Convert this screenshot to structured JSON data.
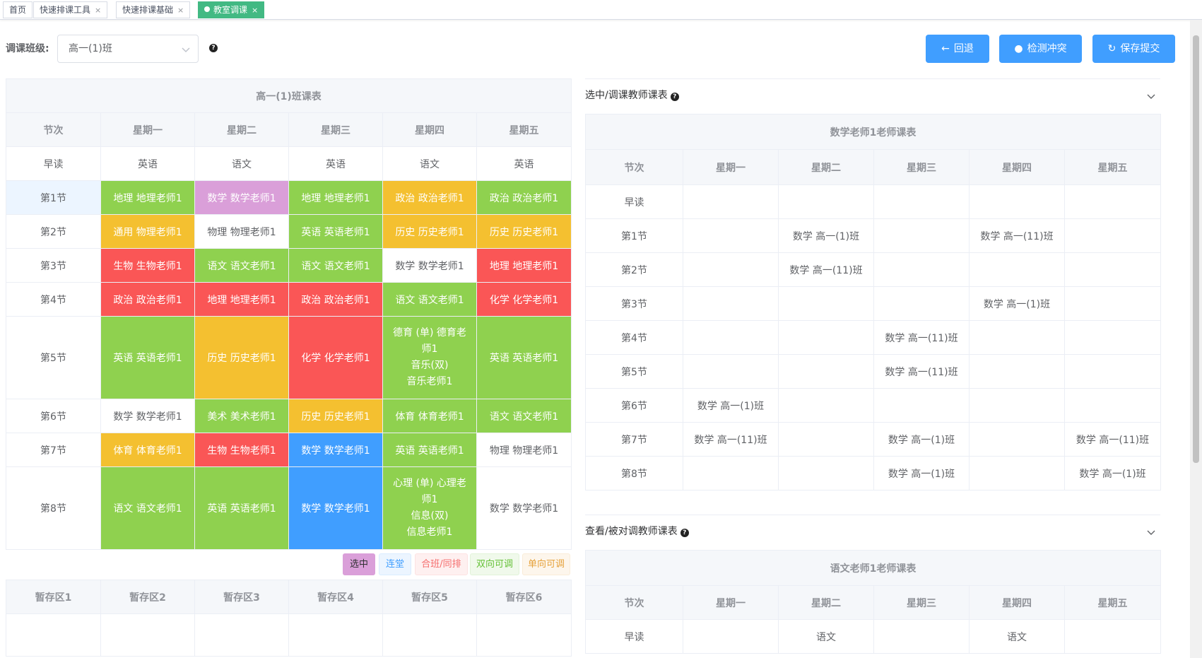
{
  "tabs": [
    {
      "label": "首页",
      "closable": false
    },
    {
      "label": "快速排课工具",
      "closable": true
    },
    {
      "label": "快速排课基础",
      "closable": true
    },
    {
      "label": "教室调课",
      "closable": true,
      "active": true
    }
  ],
  "filter": {
    "label": "调课班级:",
    "selected": "高一(1)班"
  },
  "buttons": {
    "back": "回退",
    "check": "检测冲突",
    "save": "保存提交"
  },
  "class_table": {
    "title": "高一(1)班课表",
    "headers": [
      "节次",
      "星期一",
      "星期二",
      "星期三",
      "星期四",
      "星期五"
    ],
    "rows": [
      {
        "period": "早读",
        "cells": [
          "英语",
          "语文",
          "英语",
          "语文",
          "英语"
        ]
      },
      {
        "period": "第1节",
        "cells": [
          "地理 地理老师1",
          "数学 数学老师1",
          "地理 地理老师1",
          "政治 政治老师1",
          "政治 政治老师1"
        ]
      },
      {
        "period": "第2节",
        "cells": [
          "通用 物理老师1",
          "物理 物理老师1",
          "英语 英语老师1",
          "历史 历史老师1",
          "历史 历史老师1"
        ]
      },
      {
        "period": "第3节",
        "cells": [
          "生物 生物老师1",
          "语文 语文老师1",
          "语文 语文老师1",
          "数学 数学老师1",
          "地理 地理老师1"
        ]
      },
      {
        "period": "第4节",
        "cells": [
          "政治 政治老师1",
          "地理 地理老师1",
          "政治 政治老师1",
          "语文 语文老师1",
          "化学 化学老师1"
        ]
      },
      {
        "period": "第5节",
        "cells": [
          "英语 英语老师1",
          "历史 历史老师1",
          "化学 化学老师1",
          "德育 (单) 德育老|师1|音乐(双)|音乐老师1",
          "英语 英语老师1"
        ]
      },
      {
        "period": "第6节",
        "cells": [
          "数学 数学老师1",
          "美术 美术老师1",
          "历史 历史老师1",
          "体育 体育老师1",
          "语文 语文老师1"
        ]
      },
      {
        "period": "第7节",
        "cells": [
          "体育 体育老师1",
          "生物 生物老师1",
          "数学 数学老师1",
          "英语 英语老师1",
          "物理 物理老师1"
        ]
      },
      {
        "period": "第8节",
        "cells": [
          "语文 语文老师1",
          "英语 英语老师1",
          "数学 数学老师1",
          "心理 (单) 心理老|师1|信息(双)|信息老师1",
          "数学 数学老师1"
        ]
      }
    ]
  },
  "legend": [
    "选中",
    "连堂",
    "合班/同排",
    "双向可调",
    "单向可调"
  ],
  "staging": [
    "暂存区1",
    "暂存区2",
    "暂存区3",
    "暂存区4",
    "暂存区5",
    "暂存区6"
  ],
  "teacher_section": {
    "title": "选中/调课教师课表",
    "table_title": "数学老师1老师课表",
    "headers": [
      "节次",
      "星期一",
      "星期二",
      "星期三",
      "星期四",
      "星期五"
    ],
    "rows": [
      {
        "period": "早读",
        "cells": [
          "",
          "",
          "",
          "",
          ""
        ]
      },
      {
        "period": "第1节",
        "cells": [
          "",
          "数学 高一(1)班",
          "",
          "数学 高一(11)班",
          ""
        ]
      },
      {
        "period": "第2节",
        "cells": [
          "",
          "数学 高一(11)班",
          "",
          "",
          ""
        ]
      },
      {
        "period": "第3节",
        "cells": [
          "",
          "",
          "",
          "数学 高一(1)班",
          ""
        ]
      },
      {
        "period": "第4节",
        "cells": [
          "",
          "",
          "数学 高一(11)班",
          "",
          ""
        ]
      },
      {
        "period": "第5节",
        "cells": [
          "",
          "",
          "数学 高一(11)班",
          "",
          ""
        ]
      },
      {
        "period": "第6节",
        "cells": [
          "数学 高一(1)班",
          "",
          "",
          "",
          ""
        ]
      },
      {
        "period": "第7节",
        "cells": [
          "数学 高一(11)班",
          "",
          "数学 高一(1)班",
          "",
          "数学 高一(11)班"
        ]
      },
      {
        "period": "第8节",
        "cells": [
          "",
          "",
          "数学 高一(1)班",
          "",
          "数学 高一(1)班"
        ]
      }
    ]
  },
  "target_section": {
    "title": "查看/被对调教师课表",
    "table_title": "语文老师1老师课表",
    "headers": [
      "节次",
      "星期一",
      "星期二",
      "星期三",
      "星期四",
      "星期五"
    ],
    "rows": [
      {
        "period": "早读",
        "cells": [
          "",
          "语文",
          "",
          "语文",
          ""
        ]
      }
    ]
  },
  "colors": {
    "accent": "#409eff",
    "green": "#8fd14f",
    "purple": "#da9fd9",
    "orange": "#f4c030",
    "red": "#fa5656",
    "tab_active": "#42b983"
  }
}
